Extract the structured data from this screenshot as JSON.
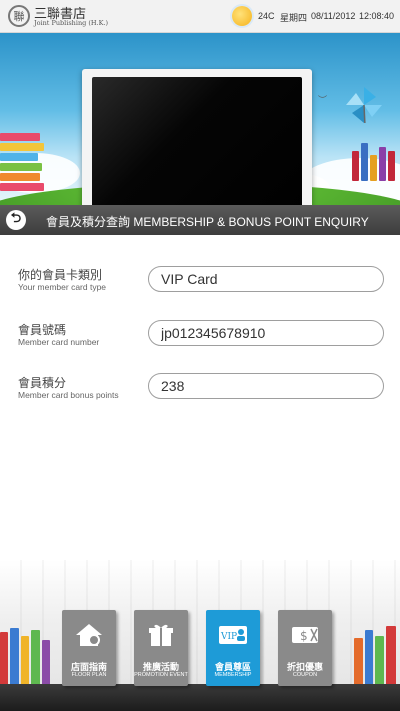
{
  "topbar": {
    "logo_mark": "聯",
    "logo_name_zh": "三聯書店",
    "logo_name_en": "Joint Publishing (H.K.)",
    "temperature": "24C",
    "weekday": "星期四",
    "date": "08/11/2012",
    "time": "12:08:40",
    "weather_icon": "sunny-icon"
  },
  "section": {
    "back_icon": "back-arrow-icon",
    "title": "會員及積分查詢 MEMBERSHIP & BONUS POINT ENQUIRY"
  },
  "form": {
    "fields": [
      {
        "label_zh": "你的會員卡類別",
        "label_en": "Your member card type",
        "value": "VIP Card"
      },
      {
        "label_zh": "會員號碼",
        "label_en": "Member card number",
        "value": "jp012345678910"
      },
      {
        "label_zh": "會員積分",
        "label_en": "Member card bonus points",
        "value": "238"
      }
    ]
  },
  "nav": {
    "items": [
      {
        "label_zh": "店面指南",
        "label_en": "FLOOR PLAN",
        "icon": "house-search-icon",
        "color": "#8a8a8a",
        "active": false
      },
      {
        "label_zh": "推廣活動",
        "label_en": "PROMOTION EVENT",
        "icon": "gift-box-icon",
        "color": "#8a8a8a",
        "active": false
      },
      {
        "label_zh": "會員尊區",
        "label_en": "MEMBERSHIP",
        "icon": "vip-card-icon",
        "color": "#1e9bd7",
        "active": true
      },
      {
        "label_zh": "折扣優惠",
        "label_en": "COUPON",
        "icon": "coupon-icon",
        "color": "#8a8a8a",
        "active": false
      }
    ]
  },
  "colors": {
    "section_bar": "#4a4a4a",
    "active_nav": "#1e9bd7",
    "inactive_nav": "#8a8a8a"
  }
}
